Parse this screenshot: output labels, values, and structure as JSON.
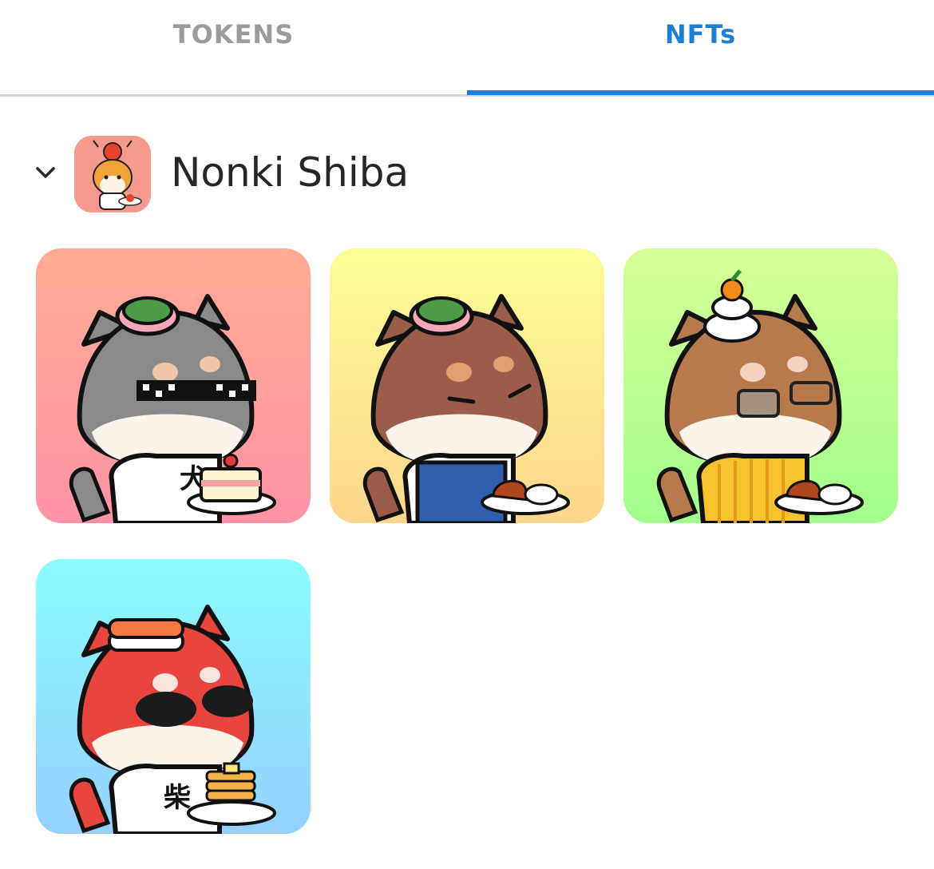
{
  "tabs": [
    {
      "label": "TOKENS",
      "active": false
    },
    {
      "label": "NFTs",
      "active": true
    }
  ],
  "colors": {
    "accent": "#1a7fd8",
    "inactive_tab": "#9b9b9b",
    "text": "#24272a"
  },
  "collection": {
    "name": "Nonki Shiba",
    "expand_icon": "chevron-down-icon",
    "nfts": [
      {
        "fur": "gray",
        "topping": "sakura-mochi",
        "eyewear": "pixel-sunglasses",
        "shirt_glyph": "犬",
        "dish": "strawberry-cake"
      },
      {
        "fur": "brown",
        "topping": "sakura-mochi",
        "eyewear": "none",
        "shirt_glyph": "",
        "dish": "curry-rice"
      },
      {
        "fur": "tan",
        "topping": "kagami-mochi",
        "eyewear": "glasses",
        "shirt_glyph": "",
        "dish": "curry-rice"
      },
      {
        "fur": "red",
        "topping": "salmon-sushi",
        "eyewear": "sunglasses",
        "shirt_glyph": "柴",
        "dish": "pancakes"
      }
    ]
  }
}
